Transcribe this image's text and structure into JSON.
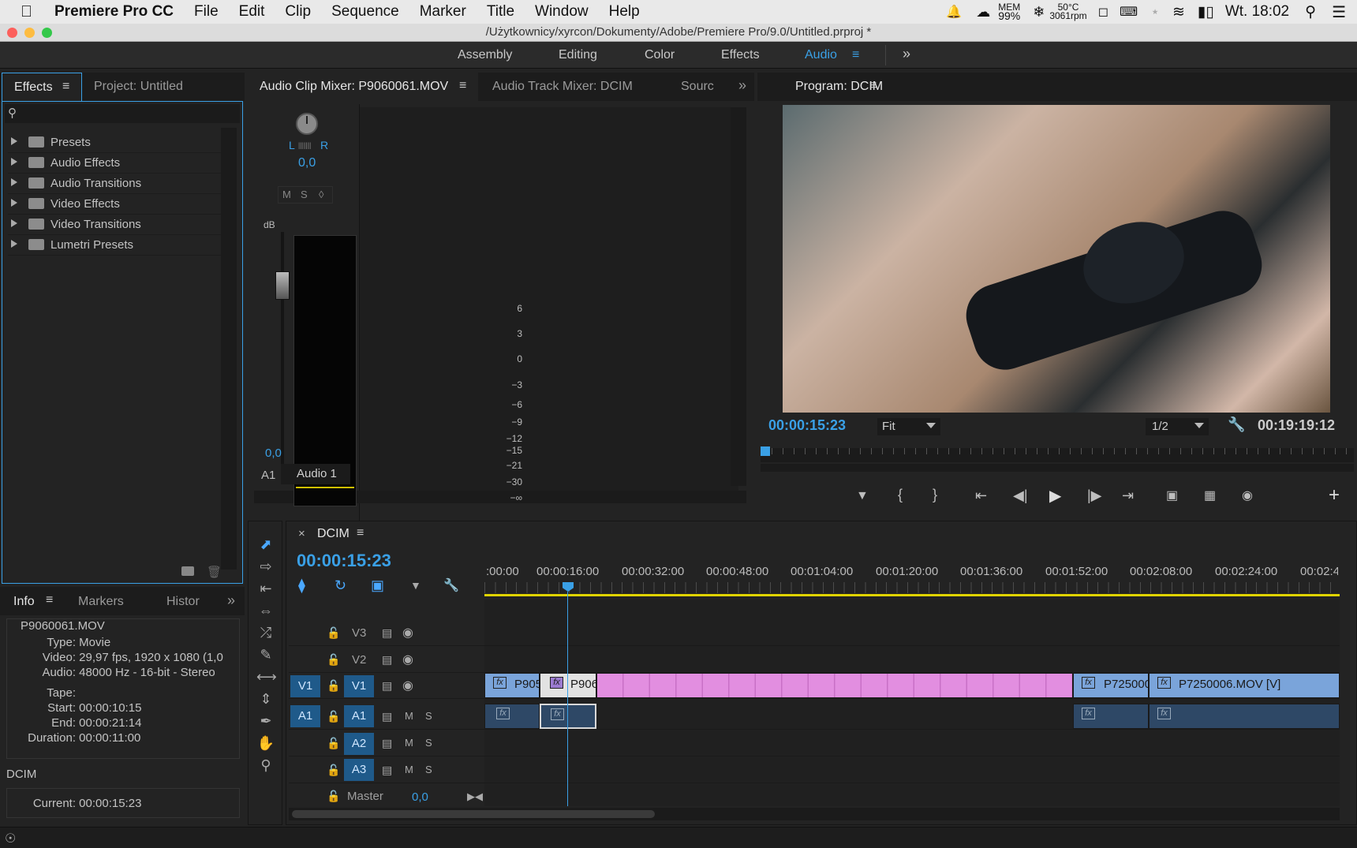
{
  "menubar": {
    "app": "Premiere Pro CC",
    "items": [
      "File",
      "Edit",
      "Clip",
      "Sequence",
      "Marker",
      "Title",
      "Window",
      "Help"
    ],
    "mem_label": "MEM",
    "mem_val": "99%",
    "temp": "50°C",
    "rpm": "3061rpm",
    "clock": "Wt. 18:02"
  },
  "window": {
    "title": "/Użytkownicy/xyrcon/Dokumenty/Adobe/Premiere Pro/9.0/Untitled.prproj *"
  },
  "workspaces": {
    "items": [
      "Assembly",
      "Editing",
      "Color",
      "Effects",
      "Audio"
    ],
    "active": "Audio"
  },
  "effects": {
    "tab_effects": "Effects",
    "tab_project": "Project: Untitled",
    "items": [
      "Presets",
      "Audio Effects",
      "Audio Transitions",
      "Video Effects",
      "Video Transitions",
      "Lumetri Presets"
    ]
  },
  "mixer": {
    "tab_clip": "Audio Clip Mixer: P9060061.MOV",
    "tab_track": "Audio Track Mixer: DCIM",
    "tab_source": "Sourc",
    "pan_l": "L",
    "pan_r": "R",
    "pan_value": "0,0",
    "btn_m": "M",
    "btn_s": "S",
    "db_label": "dB",
    "db_ticks": [
      "6",
      "3",
      "0",
      "−3",
      "−6",
      "−9",
      "−12",
      "−15",
      "−21",
      "−30",
      "−∞"
    ],
    "fader_value": "0,0",
    "track_id": "A1",
    "track_name": "Audio 1"
  },
  "program": {
    "title": "Program: DCIM",
    "timecode": "00:00:15:23",
    "fit": "Fit",
    "resolution": "1/2",
    "duration": "00:19:19:12"
  },
  "info": {
    "tab_info": "Info",
    "tab_markers": "Markers",
    "tab_history": "Histor",
    "clip_name": "P9060061.MOV",
    "rows": [
      {
        "k": "Type:",
        "v": "Movie"
      },
      {
        "k": "Video:",
        "v": "29,97 fps, 1920 x 1080 (1,0"
      },
      {
        "k": "Audio:",
        "v": "48000 Hz - 16-bit - Stereo"
      },
      {
        "k": "Tape:",
        "v": ""
      },
      {
        "k": "Start:",
        "v": "00:00:10:15"
      },
      {
        "k": "End:",
        "v": "00:00:21:14"
      },
      {
        "k": "Duration:",
        "v": "00:00:11:00"
      }
    ],
    "seq_name": "DCIM",
    "current_label": "Current:",
    "current_val": "00:00:15:23"
  },
  "timeline": {
    "seq_tab": "DCIM",
    "timecode": "00:00:15:23",
    "ruler": [
      ":00:00",
      "00:00:16:00",
      "00:00:32:00",
      "00:00:48:00",
      "00:01:04:00",
      "00:01:20:00",
      "00:01:36:00",
      "00:01:52:00",
      "00:02:08:00",
      "00:02:24:00",
      "00:02:4"
    ],
    "tracks": {
      "v3": "V3",
      "v2": "V2",
      "v1": "V1",
      "a1": "A1",
      "a2": "A2",
      "a3": "A3",
      "master": "Master",
      "master_val": "0,0",
      "m": "M",
      "s": "S"
    },
    "clips": {
      "c1": "P905",
      "c2": "P906",
      "c3": "P725000",
      "c4": "P7250006.MOV [V]"
    }
  },
  "icons": [
    "apple-icon",
    "bell-icon",
    "search-icon",
    "menu-icon",
    "lock-icon",
    "eye-icon",
    "play-icon",
    "wrench-icon",
    "camera-icon",
    "folder-icon",
    "trash-icon"
  ]
}
